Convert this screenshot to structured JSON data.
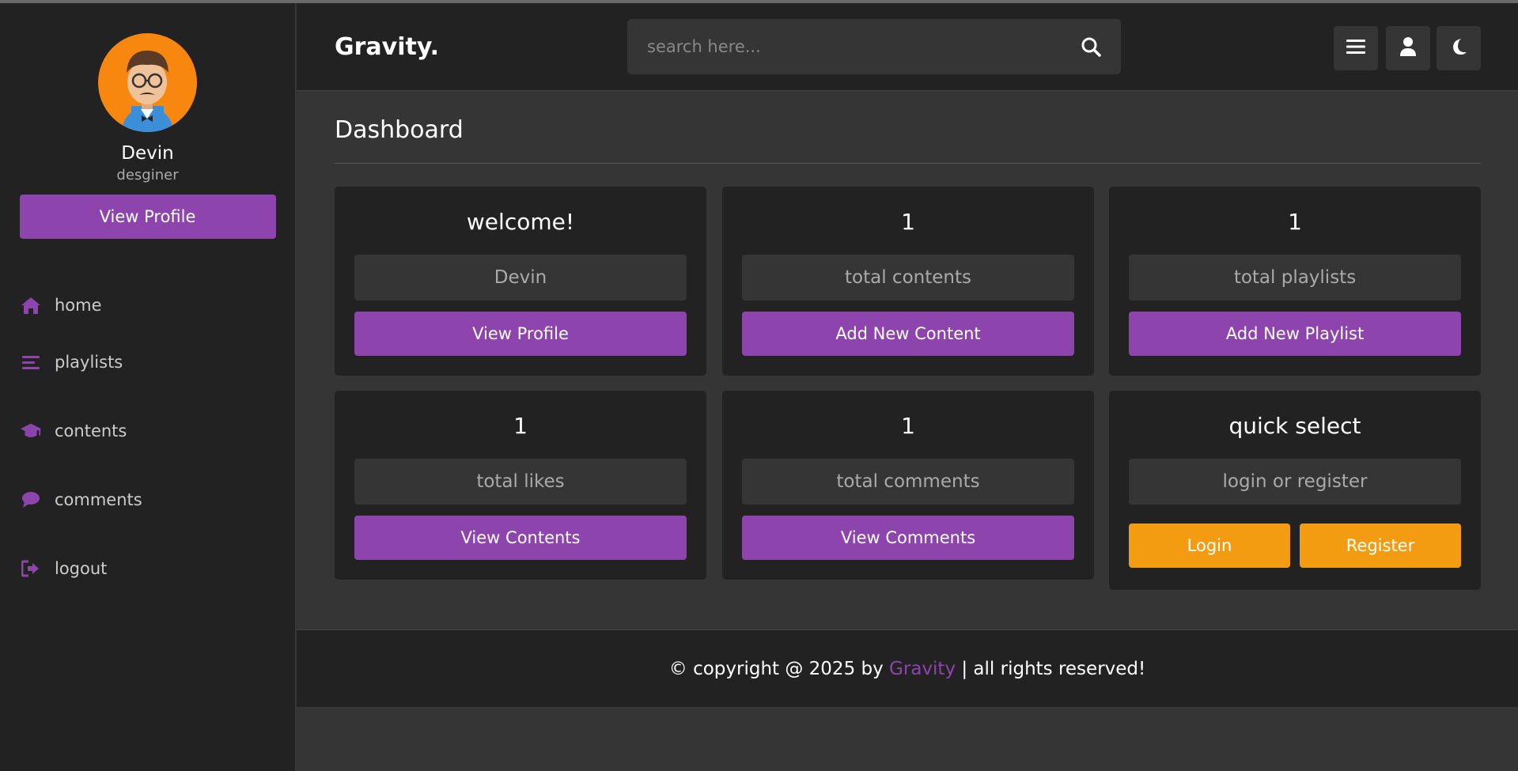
{
  "colors": {
    "accent": "#8e44ad",
    "orange": "#f39c12",
    "avatar_bg": "#f7870e",
    "bg": "#353535",
    "panel": "#222222"
  },
  "sidebar": {
    "profile": {
      "name": "Devin",
      "role": "desginer",
      "view_profile_label": "View Profile"
    },
    "items": [
      {
        "label": "home",
        "icon": "home-icon"
      },
      {
        "label": "playlists",
        "icon": "list-icon"
      },
      {
        "label": "contents",
        "icon": "graduation-cap-icon"
      },
      {
        "label": "comments",
        "icon": "comment-icon"
      },
      {
        "label": "logout",
        "icon": "logout-icon"
      }
    ]
  },
  "header": {
    "logo": "Gravity.",
    "search": {
      "placeholder": "search here..."
    },
    "buttons": [
      "menu-icon",
      "user-icon",
      "moon-icon"
    ]
  },
  "main": {
    "title": "Dashboard",
    "cards": [
      {
        "heading": "welcome!",
        "box": "Devin",
        "button": "View Profile"
      },
      {
        "heading": "1",
        "box": "total contents",
        "button": "Add New Content"
      },
      {
        "heading": "1",
        "box": "total playlists",
        "button": "Add New Playlist"
      },
      {
        "heading": "1",
        "box": "total likes",
        "button": "View Contents"
      },
      {
        "heading": "1",
        "box": "total comments",
        "button": "View Comments"
      }
    ],
    "quick_select": {
      "heading": "quick select",
      "box": "login or register",
      "login_label": "Login",
      "register_label": "Register"
    }
  },
  "footer": {
    "prefix": "© copyright @ 2025 by ",
    "brand": "Gravity",
    "suffix": " | all rights reserved!"
  }
}
